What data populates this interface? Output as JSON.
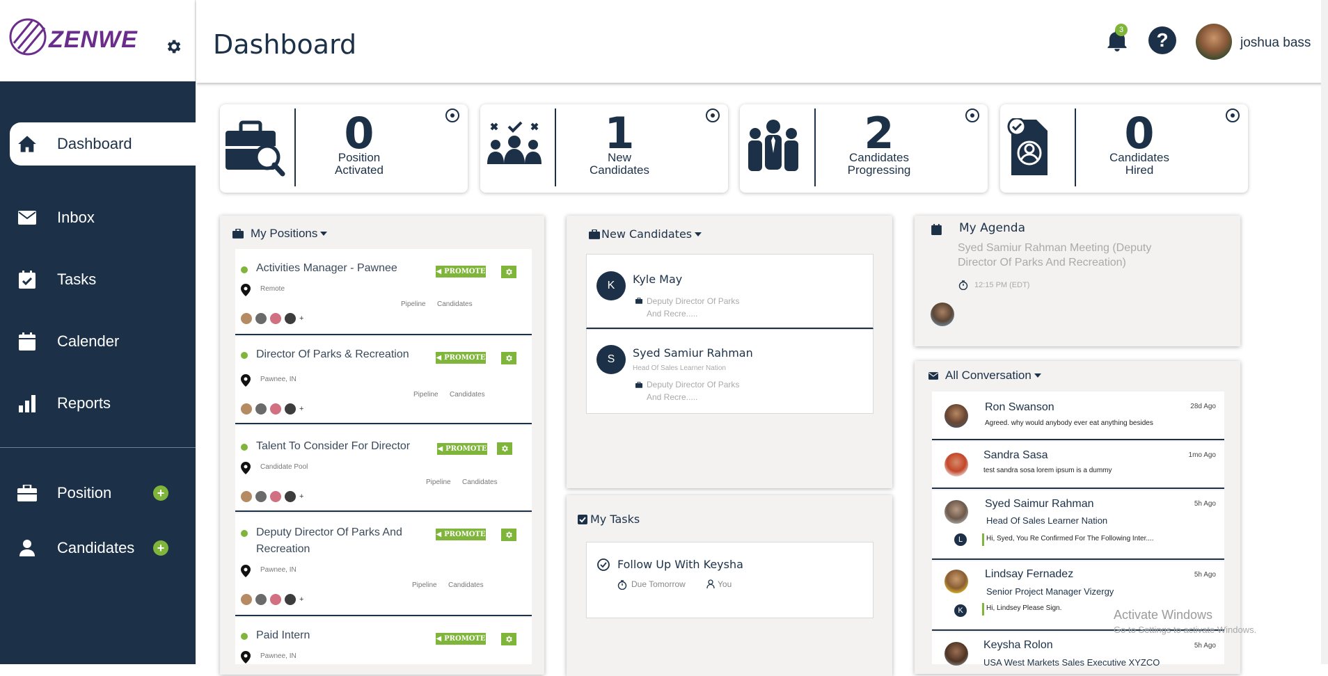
{
  "app": {
    "logo_text": "ZENWE"
  },
  "header": {
    "title": "Dashboard",
    "notification_count": "3",
    "help_glyph": "?",
    "user_name": "joshua bass"
  },
  "sidebar": {
    "items": [
      {
        "label": "Dashboard",
        "icon": "home-icon"
      },
      {
        "label": "Inbox",
        "icon": "envelope-icon"
      },
      {
        "label": "Tasks",
        "icon": "calendar-check-icon"
      },
      {
        "label": "Calender",
        "icon": "calendar-icon"
      },
      {
        "label": "Reports",
        "icon": "bar-chart-icon"
      },
      {
        "label": "Position",
        "icon": "briefcase-icon"
      },
      {
        "label": "Candidates",
        "icon": "user-icon"
      }
    ],
    "plus_glyph": "+"
  },
  "stats": [
    {
      "value": "0",
      "label_line1": "Position",
      "label_line2": "Activated"
    },
    {
      "value": "1",
      "label_line1": "New",
      "label_line2": "Candidates"
    },
    {
      "value": "2",
      "label_line1": "Candidates",
      "label_line2": "Progressing"
    },
    {
      "value": "0",
      "label_line1": "Candidates",
      "label_line2": "Hired"
    }
  ],
  "positions": {
    "title": "My Positions",
    "promote_label": "PROMOTE",
    "pipeline_label": "Pipeline",
    "candidates_label": "Candidates",
    "more_glyph": "+",
    "items": [
      {
        "title": "Activities Manager - Pawnee",
        "location": "Remote"
      },
      {
        "title": "Director Of Parks & Recreation",
        "location": "Pawnee, IN"
      },
      {
        "title": "Talent To Consider For Director",
        "location": "Candidate Pool"
      },
      {
        "title": "Deputy Director Of Parks And Recreation",
        "location": "Pawnee, IN"
      },
      {
        "title": "Paid Intern",
        "location": "Pawnee, IN"
      }
    ]
  },
  "new_candidates": {
    "title": "New Candidates",
    "items": [
      {
        "initial": "K",
        "name": "Kyle May",
        "subtitle": "",
        "position_line1": "Deputy Director Of Parks",
        "position_line2": "And Recre....."
      },
      {
        "initial": "S",
        "name": "Syed Samiur Rahman",
        "subtitle": "Head Of Sales Learner Nation",
        "position_line1": "Deputy Director Of Parks",
        "position_line2": "And Recre....."
      }
    ]
  },
  "tasks": {
    "title": "My Tasks",
    "items": [
      {
        "title": "Follow Up With Keysha",
        "due": "Due Tomorrow",
        "assignee": "You"
      }
    ]
  },
  "agenda": {
    "title": "My Agenda",
    "event_line1": "Syed Samiur Rahman Meeting (Deputy",
    "event_line2": "Director Of Parks And Recreation)",
    "time": "12:15 PM (EDT)"
  },
  "conversations": {
    "title": "All Conversation",
    "items": [
      {
        "name": "Ron Swanson",
        "time": "28d Ago",
        "message": "Agreed. why would anybody ever eat anything besides"
      },
      {
        "name": "Sandra Sasa",
        "time": "1mo Ago",
        "message": "test sandra sosa lorem ipsum is a dummy"
      },
      {
        "name": "Syed Saimur Rahman",
        "time": "5h Ago",
        "subtitle": "Head Of Sales Learner Nation",
        "initial": "L",
        "message": "Hi, Syed, You Re Confirmed For The Following Inter...."
      },
      {
        "name": "Lindsay Fernadez",
        "time": "5h Ago",
        "subtitle": "Senior Project Manager Vizergy",
        "initial": "K",
        "message": "Hi, Lindsey Please Sign."
      },
      {
        "name": "Keysha Rolon",
        "time": "5h Ago",
        "subtitle": "USA West Markets Sales Executive XYZCO"
      }
    ]
  },
  "watermark": {
    "line1": "Activate Windows",
    "line2": "Go to Settings to activate Windows."
  },
  "colors": {
    "navy": "#1c3148",
    "green": "#7fb53b",
    "purple": "#6a2d8c"
  }
}
